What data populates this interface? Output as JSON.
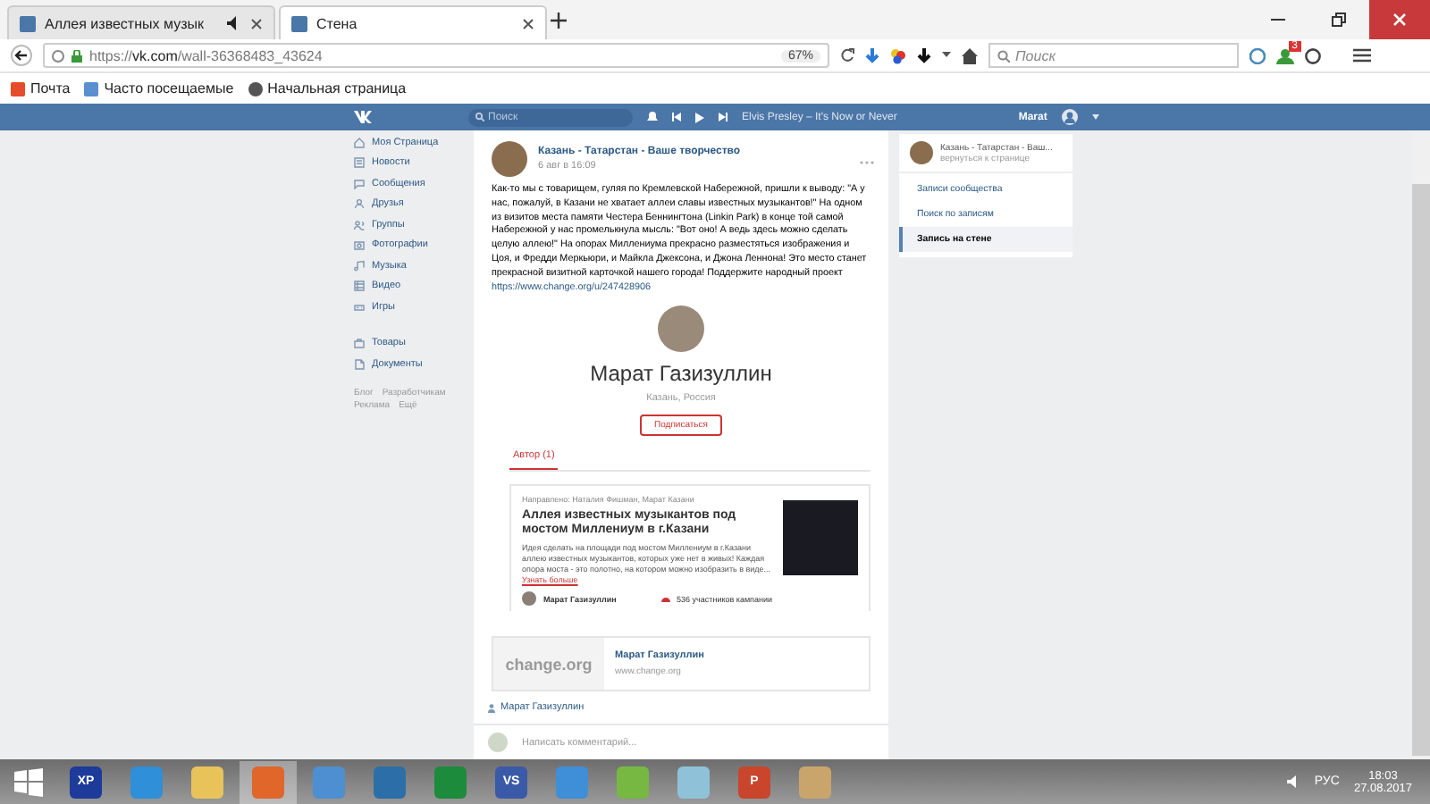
{
  "browser": {
    "tabs": [
      {
        "title": "Аллея известных музык",
        "selected": false,
        "audio": true
      },
      {
        "title": "Стена",
        "selected": true,
        "audio": false
      }
    ],
    "url": {
      "scheme": "https://",
      "host": "vk.com",
      "path": "/wall-36368483_43624"
    },
    "zoom": "67%",
    "search_placeholder": "Поиск",
    "notification_count": "3",
    "bookmarks": [
      {
        "kind": "mail",
        "label": "Почта"
      },
      {
        "kind": "page",
        "label": "Часто посещаемые"
      },
      {
        "kind": "globe",
        "label": "Начальная страница"
      }
    ]
  },
  "vk_header": {
    "search_placeholder": "Поиск",
    "now_playing": "Elvis Presley – It's Now or Never",
    "user": "Marat"
  },
  "sidebar": {
    "items": [
      {
        "kind": "home",
        "label": "Моя Страница"
      },
      {
        "kind": "news",
        "label": "Новости"
      },
      {
        "kind": "chat",
        "label": "Сообщения"
      },
      {
        "kind": "friend",
        "label": "Друзья"
      },
      {
        "kind": "group",
        "label": "Группы"
      },
      {
        "kind": "photo",
        "label": "Фотографии"
      },
      {
        "kind": "music",
        "label": "Музыка"
      },
      {
        "kind": "video",
        "label": "Видео"
      },
      {
        "kind": "game",
        "label": "Игры"
      }
    ],
    "extra_items": [
      {
        "kind": "bag",
        "label": "Товары"
      },
      {
        "kind": "doc",
        "label": "Документы"
      }
    ],
    "footer_links": [
      "Блог",
      "Разработчикам",
      "Реклама",
      "Ещё"
    ]
  },
  "post": {
    "author": "Казань - Татарстан - Ваше творчество",
    "date": "6 авг в 16:09",
    "text": "Как-то мы с товарищем, гуляя по Кремлевской Набережной, пришли к выводу: \"А у нас, пожалуй, в Казани не хватает аллеи славы известных музыкантов!\" На одном из визитов места памяти Честера Беннингтона (Linkin Park) в конце той самой Набережной у нас промелькнула мысль: \"Вот оно! А ведь здесь можно сделать целую аллею!\" На опорах Миллениума прекрасно разместяться изображения и Цоя, и Фредди Меркьюри, и Майкла Джексона, и Джона Леннона! Это место станет прекрасной визитной карточкой нашего города! Поддержите народный проект",
    "link": "https://www.change.org/u/247428906",
    "profile": {
      "name": "Марат Газизуллин",
      "location": "Казань, Россия",
      "button": "Подписаться",
      "tabs": [
        {
          "label": "Автор (1)",
          "selected": true
        }
      ]
    },
    "petition": {
      "meta": "Направлено: Наталия Фишман, Марат Казани",
      "title": "Аллея известных музыкантов под мостом Миллениум в г.Казани",
      "description": "Идея сделать на площади под мостом Миллениум в г.Казани аллею известных музыкантов, которых уже нет в живых! Каждая опора моста - это полотно, на котором можно изобразить в виде...",
      "more": "Узнать больше",
      "author": "Марат Газизуллин",
      "supporters": "536 участников кампании"
    },
    "link_card": {
      "logo": "change.org",
      "title": "Марат Газизуллин",
      "domain": "www.change.org"
    },
    "signature": "Марат Газизуллин",
    "comment_placeholder": "Написать комментарий..."
  },
  "right_panel": {
    "group": "Казань - Татарстан - Ваш...",
    "back": "вернуться к странице",
    "items": [
      {
        "label": "Записи сообщества",
        "selected": false
      },
      {
        "label": "Поиск по записям",
        "selected": false
      },
      {
        "label": "Запись на стене",
        "selected": true
      }
    ]
  },
  "taskbar": {
    "apps": [
      {
        "kind": "xp",
        "label": "XP",
        "selected": false
      },
      {
        "kind": "ie",
        "selected": false
      },
      {
        "kind": "folder",
        "selected": false
      },
      {
        "kind": "firefox",
        "selected": true
      },
      {
        "kind": "sound",
        "selected": false
      },
      {
        "kind": "monitor",
        "selected": false
      },
      {
        "kind": "store",
        "selected": false
      },
      {
        "kind": "vs",
        "label": "VS",
        "selected": false
      },
      {
        "kind": "intel",
        "selected": false
      },
      {
        "kind": "torrent",
        "selected": false
      },
      {
        "kind": "notes",
        "selected": false
      },
      {
        "kind": "ppt",
        "label": "P",
        "selected": false
      },
      {
        "kind": "paint",
        "selected": false
      }
    ],
    "language": "РУС",
    "time": "18:03",
    "date": "27.08.2017"
  }
}
